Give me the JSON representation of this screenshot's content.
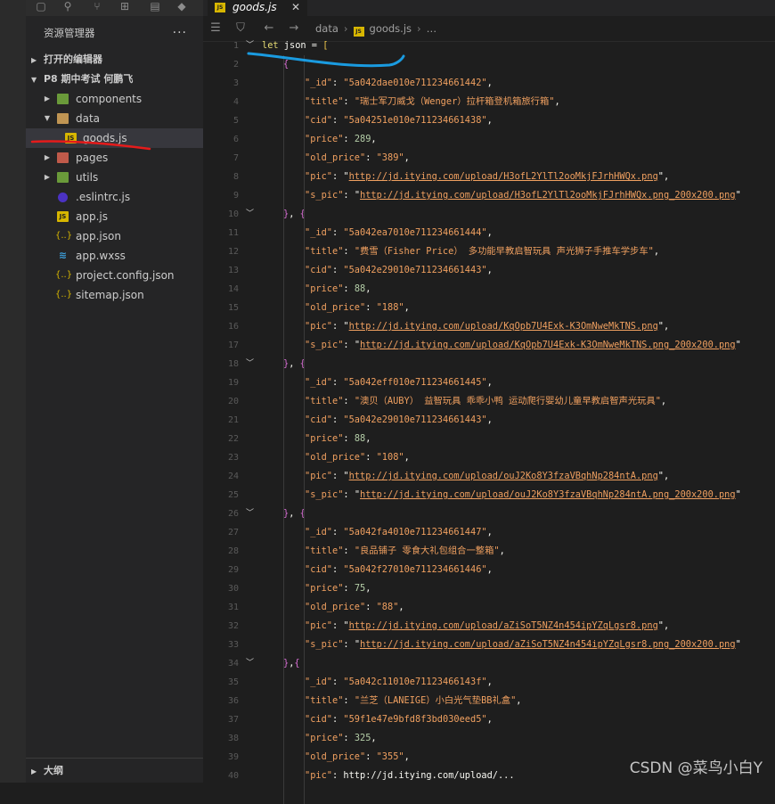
{
  "colors": {
    "accent_blue": "#179fff",
    "annotation_red": "#e51b1b",
    "annotation_blue": "#1a9be0"
  },
  "tab": {
    "title": "goods.js",
    "close": "✕"
  },
  "breadcrumb": {
    "folder": "data",
    "file": "goods.js",
    "more": "…"
  },
  "explorer": {
    "header": "资源管理器",
    "more": "···",
    "open_editors": "打开的编辑器",
    "project": "P8 期中考试 何鹏飞",
    "items": [
      {
        "label": "components",
        "icon": "folder-icon"
      },
      {
        "label": "data",
        "icon": "folder-open-icon"
      },
      {
        "label": "goods.js",
        "icon": "js-file-icon"
      },
      {
        "label": "pages",
        "icon": "folder-icon"
      },
      {
        "label": "utils",
        "icon": "folder-icon"
      },
      {
        "label": ".eslintrc.js",
        "icon": "eslint-icon"
      },
      {
        "label": "app.js",
        "icon": "js-file-icon"
      },
      {
        "label": "app.json",
        "icon": "json-file-icon"
      },
      {
        "label": "app.wxss",
        "icon": "css-file-icon"
      },
      {
        "label": "project.config.json",
        "icon": "json-file-icon"
      },
      {
        "label": "sitemap.json",
        "icon": "json-file-icon"
      }
    ],
    "outline": "大纲"
  },
  "code": [
    {
      "n": "1",
      "t": "let json = ["
    },
    {
      "n": "2",
      "t": "{"
    },
    {
      "n": "3",
      "t": "\"_id\": \"5a042dae010e711234661442\","
    },
    {
      "n": "4",
      "t": "\"title\": \"瑞士军刀威戈（Wenger）拉杆箱登机箱旅行箱\","
    },
    {
      "n": "5",
      "t": "\"cid\": \"5a04251e010e711234661438\","
    },
    {
      "n": "6",
      "t": "\"price\": 289,"
    },
    {
      "n": "7",
      "t": "\"old_price\": \"389\","
    },
    {
      "n": "8",
      "t": "\"pic\": \"http://jd.itying.com/upload/H3ofL2YlTl2ooMkjFJrhHWQx.png\","
    },
    {
      "n": "9",
      "t": "\"s_pic\": \"http://jd.itying.com/upload/H3ofL2YlTl2ooMkjFJrhHWQx.png_200x200.png\""
    },
    {
      "n": "10",
      "t": "}, {"
    },
    {
      "n": "11",
      "t": "\"_id\": \"5a042ea7010e711234661444\","
    },
    {
      "n": "12",
      "t": "\"title\": \"费雪（Fisher Price） 多功能早教启智玩具 声光狮子手推车学步车\","
    },
    {
      "n": "13",
      "t": "\"cid\": \"5a042e29010e711234661443\","
    },
    {
      "n": "14",
      "t": "\"price\": 88,"
    },
    {
      "n": "15",
      "t": "\"old_price\": \"188\","
    },
    {
      "n": "16",
      "t": "\"pic\": \"http://jd.itying.com/upload/KqOpb7U4Exk-K3OmNweMkTNS.png\","
    },
    {
      "n": "17",
      "t": "\"s_pic\": \"http://jd.itying.com/upload/KqOpb7U4Exk-K3OmNweMkTNS.png_200x200.png\""
    },
    {
      "n": "18",
      "t": "}, {"
    },
    {
      "n": "19",
      "t": "\"_id\": \"5a042eff010e711234661445\","
    },
    {
      "n": "20",
      "t": "\"title\": \"澳贝（AUBY） 益智玩具 乖乖小鸭 运动爬行婴幼儿童早教启智声光玩具\","
    },
    {
      "n": "21",
      "t": "\"cid\": \"5a042e29010e711234661443\","
    },
    {
      "n": "22",
      "t": "\"price\": 88,"
    },
    {
      "n": "23",
      "t": "\"old_price\": \"108\","
    },
    {
      "n": "24",
      "t": "\"pic\": \"http://jd.itying.com/upload/ouJ2Ko8Y3fzaVBqhNp284ntA.png\","
    },
    {
      "n": "25",
      "t": "\"s_pic\": \"http://jd.itying.com/upload/ouJ2Ko8Y3fzaVBqhNp284ntA.png_200x200.png\""
    },
    {
      "n": "26",
      "t": "}, {"
    },
    {
      "n": "27",
      "t": "\"_id\": \"5a042fa4010e711234661447\","
    },
    {
      "n": "28",
      "t": "\"title\": \"良品铺子 零食大礼包组合一整箱\","
    },
    {
      "n": "29",
      "t": "\"cid\": \"5a042f27010e711234661446\","
    },
    {
      "n": "30",
      "t": "\"price\": 75,"
    },
    {
      "n": "31",
      "t": "\"old_price\": \"88\","
    },
    {
      "n": "32",
      "t": "\"pic\": \"http://jd.itying.com/upload/aZiSoT5NZ4n454ipYZqLgsr8.png\","
    },
    {
      "n": "33",
      "t": "\"s_pic\": \"http://jd.itying.com/upload/aZiSoT5NZ4n454ipYZqLgsr8.png_200x200.png\""
    },
    {
      "n": "34",
      "t": "},{"
    },
    {
      "n": "35",
      "t": "\"_id\": \"5a042c11010e71123466143f\","
    },
    {
      "n": "36",
      "t": "\"title\": \"兰芝（LANEIGE）小白光气垫BB礼盒\","
    },
    {
      "n": "37",
      "t": "\"cid\": \"59f1e47e9bfd8f3bd030eed5\","
    },
    {
      "n": "38",
      "t": "\"price\": 325,"
    },
    {
      "n": "39",
      "t": "\"old_price\": \"355\","
    },
    {
      "n": "40",
      "t": "\"pic\": \"http://jd.itying.com/upload/..."
    }
  ],
  "watermark": "CSDN @菜鸟小白Y"
}
